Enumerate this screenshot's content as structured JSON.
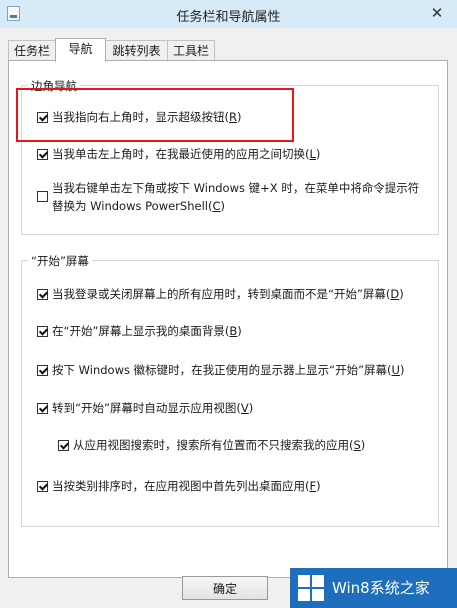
{
  "window": {
    "title": "任务栏和导航属性",
    "close_glyph": "✕"
  },
  "tabs": [
    {
      "label": "任务栏"
    },
    {
      "label": "导航"
    },
    {
      "label": "跳转列表"
    },
    {
      "label": "工具栏"
    }
  ],
  "active_tab": "导航",
  "corner_nav": {
    "legend": "边角导航",
    "options": [
      {
        "text": "当我指向右上角时，显示超级按钮(",
        "key": "R",
        "end": ")",
        "checked": true,
        "highlighted": true
      },
      {
        "text": "当我单击左上角时，在我最近使用的应用之间切换(",
        "key": "L",
        "end": ")",
        "checked": true
      },
      {
        "text": "当我右键单击左下角或按下 Windows 键+X 时，在菜单中将命令提示符",
        "text2": "替换为 Windows PowerShell(",
        "key": "C",
        "end": ")",
        "checked": false
      }
    ]
  },
  "start_screen": {
    "legend": "“开始”屏幕",
    "options": [
      {
        "text": "当我登录或关闭屏幕上的所有应用时，转到桌面而不是“开始”屏幕(",
        "key": "D",
        "end": ")",
        "checked": true
      },
      {
        "text": "在“开始”屏幕上显示我的桌面背景(",
        "key": "B",
        "end": ")",
        "checked": true
      },
      {
        "text": "按下 Windows 徽标键时，在我正使用的显示器上显示“开始”屏幕(",
        "key": "U",
        "end": ")",
        "checked": true
      },
      {
        "text": "转到“开始”屏幕时自动显示应用视图(",
        "key": "V",
        "end": ")",
        "checked": true
      },
      {
        "text": "从应用视图搜索时，搜索所有位置而不只搜索我的应用(",
        "key": "S",
        "end": ")",
        "checked": true,
        "indent": true
      },
      {
        "text": "当按类别排序时，在应用视图中首先列出桌面应用(",
        "key": "F",
        "end": ")",
        "checked": true
      }
    ]
  },
  "buttons": {
    "ok_label": "确定"
  },
  "watermark": {
    "text": "Win8系统之家"
  },
  "colors": {
    "highlight": "#e3161b",
    "titlebar": "#d6eaf7",
    "watermark_bg": "#1d6fbd"
  }
}
